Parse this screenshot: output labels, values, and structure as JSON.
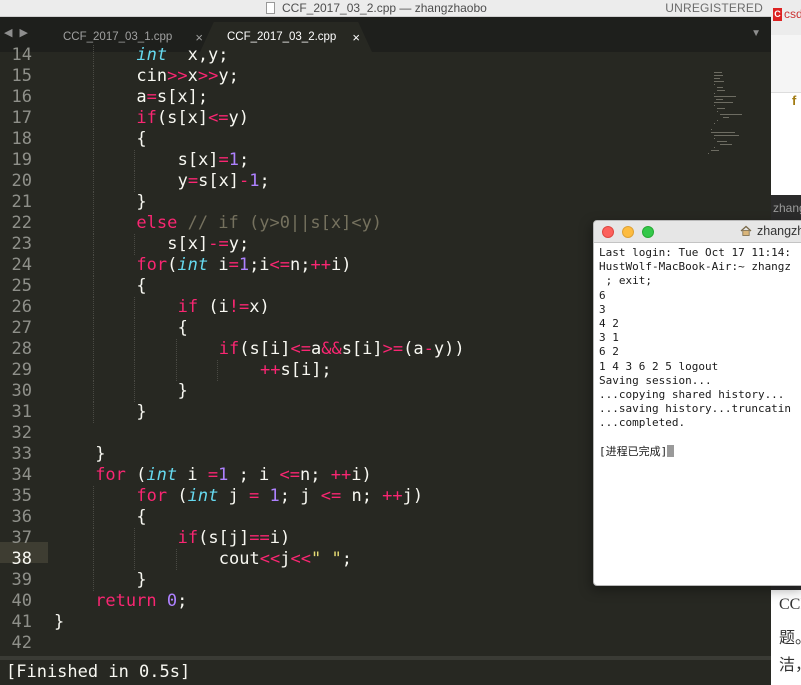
{
  "sublime": {
    "title": "CCF_2017_03_2.cpp — zhangzhaobo",
    "unregistered": "UNREGISTERED",
    "nav_arrows": "◀ ▶",
    "tabs": [
      {
        "label": "CCF_2017_03_1.cpp",
        "close": "×",
        "active": false
      },
      {
        "label": "CCF_2017_03_2.cpp",
        "close": "×",
        "active": true
      }
    ],
    "dropdown": "▼",
    "line_numbers": [
      "14",
      "15",
      "16",
      "17",
      "18",
      "19",
      "20",
      "21",
      "22",
      "23",
      "24",
      "25",
      "26",
      "27",
      "28",
      "29",
      "30",
      "31",
      "32",
      "33",
      "34",
      "35",
      "36",
      "37",
      "38",
      "39",
      "40",
      "41",
      "42"
    ],
    "active_line": "38",
    "code": [
      {
        "indent": 2,
        "tokens": [
          [
            "it",
            "int"
          ],
          [
            "",
            "  x,y;"
          ]
        ]
      },
      {
        "indent": 2,
        "tokens": [
          [
            "",
            "cin"
          ],
          [
            "op",
            ">>"
          ],
          [
            "",
            "x"
          ],
          [
            "op",
            ">>"
          ],
          [
            "",
            "y;"
          ]
        ]
      },
      {
        "indent": 2,
        "tokens": [
          [
            "",
            "a"
          ],
          [
            "op",
            "="
          ],
          [
            "",
            "s[x];"
          ]
        ]
      },
      {
        "indent": 2,
        "tokens": [
          [
            "kw",
            "if"
          ],
          [
            "",
            "(s[x]"
          ],
          [
            "op",
            "<="
          ],
          [
            "",
            "y)"
          ]
        ]
      },
      {
        "indent": 2,
        "tokens": [
          [
            "",
            "{"
          ]
        ]
      },
      {
        "indent": 3,
        "tokens": [
          [
            "",
            "s[x]"
          ],
          [
            "op",
            "="
          ],
          [
            "num",
            "1"
          ],
          [
            "",
            ";"
          ]
        ]
      },
      {
        "indent": 3,
        "tokens": [
          [
            "",
            "y"
          ],
          [
            "op",
            "="
          ],
          [
            "",
            "s[x]"
          ],
          [
            "op",
            "-"
          ],
          [
            "num",
            "1"
          ],
          [
            "",
            ";"
          ]
        ]
      },
      {
        "indent": 2,
        "tokens": [
          [
            "",
            "}"
          ]
        ]
      },
      {
        "indent": 2,
        "tokens": [
          [
            "kw",
            "else"
          ],
          [
            "cm",
            " // if (y>0||s[x]<y)"
          ]
        ]
      },
      {
        "indent": 2.75,
        "tokens": [
          [
            "",
            "s[x]"
          ],
          [
            "op",
            "-="
          ],
          [
            "",
            "y;"
          ]
        ]
      },
      {
        "indent": 2,
        "tokens": [
          [
            "kw",
            "for"
          ],
          [
            "",
            "("
          ],
          [
            "it",
            "int"
          ],
          [
            "",
            " i"
          ],
          [
            "op",
            "="
          ],
          [
            "num",
            "1"
          ],
          [
            "",
            ";i"
          ],
          [
            "op",
            "<="
          ],
          [
            "",
            "n;"
          ],
          [
            "op",
            "++"
          ],
          [
            "",
            "i)"
          ]
        ]
      },
      {
        "indent": 2,
        "tokens": [
          [
            "",
            "{"
          ]
        ]
      },
      {
        "indent": 3,
        "tokens": [
          [
            "kw",
            "if"
          ],
          [
            "",
            " (i"
          ],
          [
            "op",
            "!="
          ],
          [
            "",
            "x)"
          ]
        ]
      },
      {
        "indent": 3,
        "tokens": [
          [
            "",
            "{"
          ]
        ]
      },
      {
        "indent": 4,
        "tokens": [
          [
            "kw",
            "if"
          ],
          [
            "",
            "(s[i]"
          ],
          [
            "op",
            "<="
          ],
          [
            "",
            "a"
          ],
          [
            "op",
            "&&"
          ],
          [
            "",
            "s[i]"
          ],
          [
            "op",
            ">="
          ],
          [
            "",
            "(a"
          ],
          [
            "op",
            "-"
          ],
          [
            "",
            "y))"
          ]
        ]
      },
      {
        "indent": 5,
        "tokens": [
          [
            "op",
            "++"
          ],
          [
            "",
            "s[i];"
          ]
        ]
      },
      {
        "indent": 3,
        "tokens": [
          [
            "",
            "}"
          ]
        ]
      },
      {
        "indent": 2,
        "tokens": [
          [
            "",
            "}"
          ]
        ]
      },
      {
        "indent": 0,
        "tokens": []
      },
      {
        "indent": 1,
        "tokens": [
          [
            "",
            "}"
          ]
        ]
      },
      {
        "indent": 1,
        "tokens": [
          [
            "kw",
            "for"
          ],
          [
            "",
            " ("
          ],
          [
            "it",
            "int"
          ],
          [
            "",
            " i "
          ],
          [
            "op",
            "="
          ],
          [
            "num",
            "1"
          ],
          [
            "",
            " ; i "
          ],
          [
            "op",
            "<="
          ],
          [
            "",
            "n; "
          ],
          [
            "op",
            "++"
          ],
          [
            "",
            "i)"
          ]
        ]
      },
      {
        "indent": 2,
        "tokens": [
          [
            "kw",
            "for"
          ],
          [
            "",
            " ("
          ],
          [
            "it",
            "int"
          ],
          [
            "",
            " j "
          ],
          [
            "op",
            "="
          ],
          [
            "",
            " "
          ],
          [
            "num",
            "1"
          ],
          [
            "",
            "; j "
          ],
          [
            "op",
            "<="
          ],
          [
            "",
            " n; "
          ],
          [
            "op",
            "++"
          ],
          [
            "",
            "j)"
          ]
        ]
      },
      {
        "indent": 2,
        "tokens": [
          [
            "",
            "{"
          ]
        ]
      },
      {
        "indent": 3,
        "tokens": [
          [
            "kw",
            "if"
          ],
          [
            "",
            "(s[j]"
          ],
          [
            "op",
            "=="
          ],
          [
            "",
            "i)"
          ]
        ]
      },
      {
        "indent": 4,
        "tokens": [
          [
            "",
            "cout"
          ],
          [
            "op",
            "<<"
          ],
          [
            "",
            "j"
          ],
          [
            "op",
            "<<"
          ],
          [
            "str",
            "\" \""
          ],
          [
            "",
            ";"
          ]
        ]
      },
      {
        "indent": 2,
        "tokens": [
          [
            "",
            "}"
          ]
        ]
      },
      {
        "indent": 1,
        "tokens": [
          [
            "kw",
            "return"
          ],
          [
            "",
            " "
          ],
          [
            "num",
            "0"
          ],
          [
            "",
            ";"
          ]
        ]
      },
      {
        "indent": 0,
        "tokens": [
          [
            "",
            "}"
          ]
        ]
      },
      {
        "indent": 0,
        "tokens": []
      }
    ],
    "output": "[Finished in 0.5s]"
  },
  "background": {
    "red_text": "csdn",
    "f_glyph": "f",
    "dark_label": "zhangzhao",
    "text_lines": [
      "CCF",
      "题。",
      "洁，"
    ]
  },
  "terminal": {
    "title": "zhangzhaobo",
    "lines": [
      "Last login: Tue Oct 17 11:14:",
      "HustWolf-MacBook-Air:~ zhangz",
      " ; exit;",
      "6",
      "3",
      "4 2",
      "3 1",
      "6 2",
      "1 4 3 6 2 5 logout",
      "Saving session...",
      "...copying shared history...",
      "...saving history...truncatin",
      "...completed.",
      "",
      "[进程已完成]"
    ]
  },
  "colors": {
    "editor_bg": "#272822",
    "keyword": "#f92672",
    "type_italic": "#66d9ef",
    "number": "#ae81ff",
    "comment": "#75715e",
    "string": "#e6db74",
    "foreground": "#f8f8f2"
  }
}
